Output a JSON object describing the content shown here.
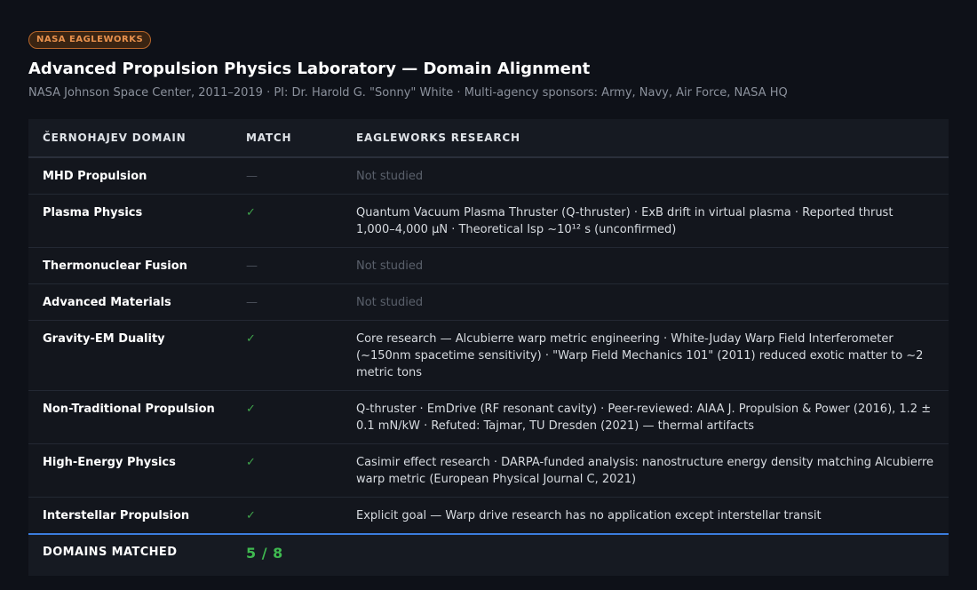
{
  "badge": "NASA EAGLEWORKS",
  "title": "Advanced Propulsion Physics Laboratory — Domain Alignment",
  "subtitle": "NASA Johnson Space Center, 2011–2019 · PI: Dr. Harold G. \"Sonny\" White · Multi-agency sponsors: Army, Navy, Air Force, NASA HQ",
  "table": {
    "headers": [
      "ČERNOHAJEV DOMAIN",
      "MATCH",
      "EAGLEWORKS RESEARCH"
    ],
    "rows": [
      {
        "domain": "MHD Propulsion",
        "match": "—",
        "matched": false,
        "research": "Not studied"
      },
      {
        "domain": "Plasma Physics",
        "match": "✓",
        "matched": true,
        "research": "Quantum Vacuum Plasma Thruster (Q-thruster) · ExB drift in virtual plasma · Reported thrust 1,000–4,000 µN · Theoretical Isp ~10¹² s (unconfirmed)"
      },
      {
        "domain": "Thermonuclear Fusion",
        "match": "—",
        "matched": false,
        "research": "Not studied"
      },
      {
        "domain": "Advanced Materials",
        "match": "—",
        "matched": false,
        "research": "Not studied"
      },
      {
        "domain": "Gravity-EM Duality",
        "match": "✓",
        "matched": true,
        "research": "Core research — Alcubierre warp metric engineering · White-Juday Warp Field Interferometer (~150nm spacetime sensitivity) · \"Warp Field Mechanics 101\" (2011) reduced exotic matter to ~2 metric tons"
      },
      {
        "domain": "Non-Traditional Propulsion",
        "match": "✓",
        "matched": true,
        "research": "Q-thruster · EmDrive (RF resonant cavity) · Peer-reviewed: AIAA J. Propulsion & Power (2016), 1.2 ± 0.1 mN/kW · Refuted: Tajmar, TU Dresden (2021) — thermal artifacts"
      },
      {
        "domain": "High-Energy Physics",
        "match": "✓",
        "matched": true,
        "research": "Casimir effect research · DARPA-funded analysis: nanostructure energy density matching Alcubierre warp metric (European Physical Journal C, 2021)"
      },
      {
        "domain": "Interstellar Propulsion",
        "match": "✓",
        "matched": true,
        "research": "Explicit goal — Warp drive research has no application except interstellar transit"
      }
    ],
    "footer": {
      "label": "DOMAINS MATCHED",
      "value": "5 / 8"
    }
  },
  "colors": {
    "background": "#0e1118",
    "accent_badge": "#e8914d",
    "match_green": "#3fa24b",
    "footer_rule": "#3b7ddd"
  }
}
